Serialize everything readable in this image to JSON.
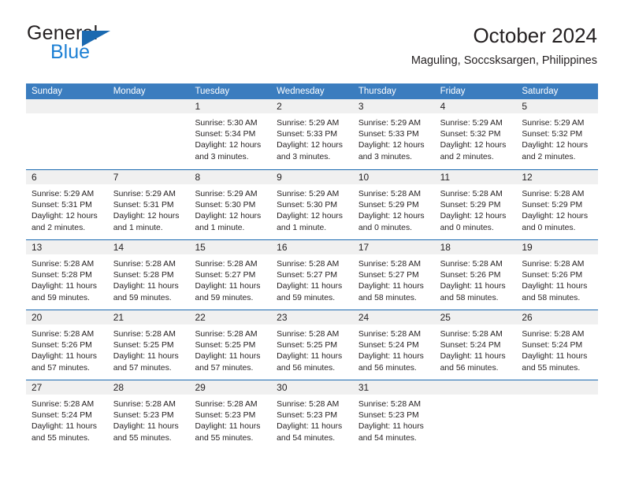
{
  "brand": {
    "name_top": "General",
    "name_bottom": "Blue",
    "triangle_color": "#1a69b0",
    "blue_text_color": "#1b7fd4"
  },
  "header": {
    "title": "October 2024",
    "location": "Maguling, Soccsksargen, Philippines"
  },
  "theme": {
    "header_bar": "#3b7dbf",
    "row_divider": "#1a69b0",
    "day_band": "#f0f0f0",
    "text": "#231f20"
  },
  "weekdays": [
    "Sunday",
    "Monday",
    "Tuesday",
    "Wednesday",
    "Thursday",
    "Friday",
    "Saturday"
  ],
  "weeks": [
    [
      {
        "day": "",
        "sunrise": "",
        "sunset": "",
        "daylight_line1": "",
        "daylight_line2": "",
        "empty": true
      },
      {
        "day": "",
        "sunrise": "",
        "sunset": "",
        "daylight_line1": "",
        "daylight_line2": "",
        "empty": true
      },
      {
        "day": "1",
        "sunrise": "Sunrise: 5:30 AM",
        "sunset": "Sunset: 5:34 PM",
        "daylight_line1": "Daylight: 12 hours",
        "daylight_line2": "and 3 minutes."
      },
      {
        "day": "2",
        "sunrise": "Sunrise: 5:29 AM",
        "sunset": "Sunset: 5:33 PM",
        "daylight_line1": "Daylight: 12 hours",
        "daylight_line2": "and 3 minutes."
      },
      {
        "day": "3",
        "sunrise": "Sunrise: 5:29 AM",
        "sunset": "Sunset: 5:33 PM",
        "daylight_line1": "Daylight: 12 hours",
        "daylight_line2": "and 3 minutes."
      },
      {
        "day": "4",
        "sunrise": "Sunrise: 5:29 AM",
        "sunset": "Sunset: 5:32 PM",
        "daylight_line1": "Daylight: 12 hours",
        "daylight_line2": "and 2 minutes."
      },
      {
        "day": "5",
        "sunrise": "Sunrise: 5:29 AM",
        "sunset": "Sunset: 5:32 PM",
        "daylight_line1": "Daylight: 12 hours",
        "daylight_line2": "and 2 minutes."
      }
    ],
    [
      {
        "day": "6",
        "sunrise": "Sunrise: 5:29 AM",
        "sunset": "Sunset: 5:31 PM",
        "daylight_line1": "Daylight: 12 hours",
        "daylight_line2": "and 2 minutes."
      },
      {
        "day": "7",
        "sunrise": "Sunrise: 5:29 AM",
        "sunset": "Sunset: 5:31 PM",
        "daylight_line1": "Daylight: 12 hours",
        "daylight_line2": "and 1 minute."
      },
      {
        "day": "8",
        "sunrise": "Sunrise: 5:29 AM",
        "sunset": "Sunset: 5:30 PM",
        "daylight_line1": "Daylight: 12 hours",
        "daylight_line2": "and 1 minute."
      },
      {
        "day": "9",
        "sunrise": "Sunrise: 5:29 AM",
        "sunset": "Sunset: 5:30 PM",
        "daylight_line1": "Daylight: 12 hours",
        "daylight_line2": "and 1 minute."
      },
      {
        "day": "10",
        "sunrise": "Sunrise: 5:28 AM",
        "sunset": "Sunset: 5:29 PM",
        "daylight_line1": "Daylight: 12 hours",
        "daylight_line2": "and 0 minutes."
      },
      {
        "day": "11",
        "sunrise": "Sunrise: 5:28 AM",
        "sunset": "Sunset: 5:29 PM",
        "daylight_line1": "Daylight: 12 hours",
        "daylight_line2": "and 0 minutes."
      },
      {
        "day": "12",
        "sunrise": "Sunrise: 5:28 AM",
        "sunset": "Sunset: 5:29 PM",
        "daylight_line1": "Daylight: 12 hours",
        "daylight_line2": "and 0 minutes."
      }
    ],
    [
      {
        "day": "13",
        "sunrise": "Sunrise: 5:28 AM",
        "sunset": "Sunset: 5:28 PM",
        "daylight_line1": "Daylight: 11 hours",
        "daylight_line2": "and 59 minutes."
      },
      {
        "day": "14",
        "sunrise": "Sunrise: 5:28 AM",
        "sunset": "Sunset: 5:28 PM",
        "daylight_line1": "Daylight: 11 hours",
        "daylight_line2": "and 59 minutes."
      },
      {
        "day": "15",
        "sunrise": "Sunrise: 5:28 AM",
        "sunset": "Sunset: 5:27 PM",
        "daylight_line1": "Daylight: 11 hours",
        "daylight_line2": "and 59 minutes."
      },
      {
        "day": "16",
        "sunrise": "Sunrise: 5:28 AM",
        "sunset": "Sunset: 5:27 PM",
        "daylight_line1": "Daylight: 11 hours",
        "daylight_line2": "and 59 minutes."
      },
      {
        "day": "17",
        "sunrise": "Sunrise: 5:28 AM",
        "sunset": "Sunset: 5:27 PM",
        "daylight_line1": "Daylight: 11 hours",
        "daylight_line2": "and 58 minutes."
      },
      {
        "day": "18",
        "sunrise": "Sunrise: 5:28 AM",
        "sunset": "Sunset: 5:26 PM",
        "daylight_line1": "Daylight: 11 hours",
        "daylight_line2": "and 58 minutes."
      },
      {
        "day": "19",
        "sunrise": "Sunrise: 5:28 AM",
        "sunset": "Sunset: 5:26 PM",
        "daylight_line1": "Daylight: 11 hours",
        "daylight_line2": "and 58 minutes."
      }
    ],
    [
      {
        "day": "20",
        "sunrise": "Sunrise: 5:28 AM",
        "sunset": "Sunset: 5:26 PM",
        "daylight_line1": "Daylight: 11 hours",
        "daylight_line2": "and 57 minutes."
      },
      {
        "day": "21",
        "sunrise": "Sunrise: 5:28 AM",
        "sunset": "Sunset: 5:25 PM",
        "daylight_line1": "Daylight: 11 hours",
        "daylight_line2": "and 57 minutes."
      },
      {
        "day": "22",
        "sunrise": "Sunrise: 5:28 AM",
        "sunset": "Sunset: 5:25 PM",
        "daylight_line1": "Daylight: 11 hours",
        "daylight_line2": "and 57 minutes."
      },
      {
        "day": "23",
        "sunrise": "Sunrise: 5:28 AM",
        "sunset": "Sunset: 5:25 PM",
        "daylight_line1": "Daylight: 11 hours",
        "daylight_line2": "and 56 minutes."
      },
      {
        "day": "24",
        "sunrise": "Sunrise: 5:28 AM",
        "sunset": "Sunset: 5:24 PM",
        "daylight_line1": "Daylight: 11 hours",
        "daylight_line2": "and 56 minutes."
      },
      {
        "day": "25",
        "sunrise": "Sunrise: 5:28 AM",
        "sunset": "Sunset: 5:24 PM",
        "daylight_line1": "Daylight: 11 hours",
        "daylight_line2": "and 56 minutes."
      },
      {
        "day": "26",
        "sunrise": "Sunrise: 5:28 AM",
        "sunset": "Sunset: 5:24 PM",
        "daylight_line1": "Daylight: 11 hours",
        "daylight_line2": "and 55 minutes."
      }
    ],
    [
      {
        "day": "27",
        "sunrise": "Sunrise: 5:28 AM",
        "sunset": "Sunset: 5:24 PM",
        "daylight_line1": "Daylight: 11 hours",
        "daylight_line2": "and 55 minutes."
      },
      {
        "day": "28",
        "sunrise": "Sunrise: 5:28 AM",
        "sunset": "Sunset: 5:23 PM",
        "daylight_line1": "Daylight: 11 hours",
        "daylight_line2": "and 55 minutes."
      },
      {
        "day": "29",
        "sunrise": "Sunrise: 5:28 AM",
        "sunset": "Sunset: 5:23 PM",
        "daylight_line1": "Daylight: 11 hours",
        "daylight_line2": "and 55 minutes."
      },
      {
        "day": "30",
        "sunrise": "Sunrise: 5:28 AM",
        "sunset": "Sunset: 5:23 PM",
        "daylight_line1": "Daylight: 11 hours",
        "daylight_line2": "and 54 minutes."
      },
      {
        "day": "31",
        "sunrise": "Sunrise: 5:28 AM",
        "sunset": "Sunset: 5:23 PM",
        "daylight_line1": "Daylight: 11 hours",
        "daylight_line2": "and 54 minutes."
      },
      {
        "day": "",
        "sunrise": "",
        "sunset": "",
        "daylight_line1": "",
        "daylight_line2": "",
        "empty": true
      },
      {
        "day": "",
        "sunrise": "",
        "sunset": "",
        "daylight_line1": "",
        "daylight_line2": "",
        "empty": true
      }
    ]
  ]
}
